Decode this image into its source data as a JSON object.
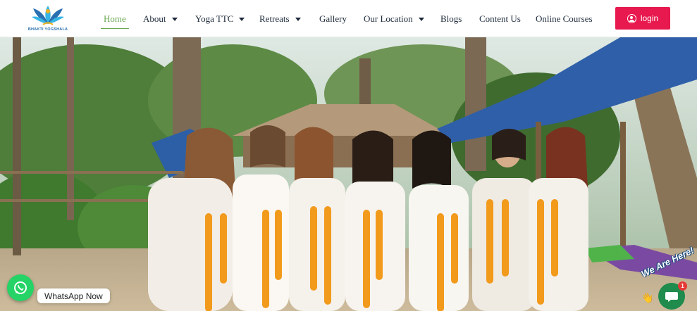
{
  "brand": {
    "name": "BHAKTI YOGSHALA",
    "logo_colors": [
      "#2a6fb0",
      "#f2b21a",
      "#37b5e5"
    ]
  },
  "nav": {
    "items": [
      {
        "label": "Home",
        "active": true,
        "has_dropdown": false
      },
      {
        "label": "About",
        "active": false,
        "has_dropdown": true
      },
      {
        "label": "Yoga TTC",
        "active": false,
        "has_dropdown": true
      },
      {
        "label": "Retreats",
        "active": false,
        "has_dropdown": true
      },
      {
        "label": "Gallery",
        "active": false,
        "has_dropdown": false
      },
      {
        "label": "Our Location",
        "active": false,
        "has_dropdown": true
      },
      {
        "label": "Blogs",
        "active": false,
        "has_dropdown": false
      },
      {
        "label": "Content Us",
        "active": false,
        "has_dropdown": false
      },
      {
        "label": "Online Courses",
        "active": false,
        "has_dropdown": false
      }
    ],
    "login_label": "login",
    "active_color": "#6aa84f",
    "login_color": "#e8194e"
  },
  "hero": {
    "image": "group-photo-women-with-marigold-garlands"
  },
  "whatsapp": {
    "label": "WhatsApp Now",
    "color": "#25d366"
  },
  "chat": {
    "title": "We Are Here!",
    "badge_count": "1",
    "color": "#1f8b4c"
  }
}
